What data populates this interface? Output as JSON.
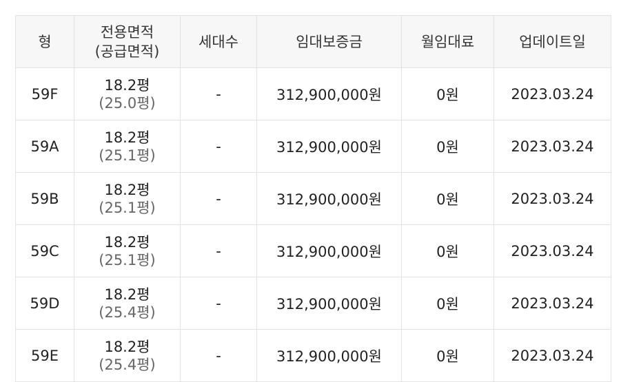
{
  "table": {
    "headers": {
      "type": "형",
      "area_line1": "전용면적",
      "area_line2": "(공급면적)",
      "households": "세대수",
      "deposit": "임대보증금",
      "rent": "월임대료",
      "updated": "업데이트일"
    },
    "rows": [
      {
        "type": "59F",
        "exclusive": "18.2평",
        "supply": "(25.0평)",
        "households": "-",
        "deposit": "312,900,000원",
        "rent": "0원",
        "updated": "2023.03.24"
      },
      {
        "type": "59A",
        "exclusive": "18.2평",
        "supply": "(25.1평)",
        "households": "-",
        "deposit": "312,900,000원",
        "rent": "0원",
        "updated": "2023.03.24"
      },
      {
        "type": "59B",
        "exclusive": "18.2평",
        "supply": "(25.1평)",
        "households": "-",
        "deposit": "312,900,000원",
        "rent": "0원",
        "updated": "2023.03.24"
      },
      {
        "type": "59C",
        "exclusive": "18.2평",
        "supply": "(25.1평)",
        "households": "-",
        "deposit": "312,900,000원",
        "rent": "0원",
        "updated": "2023.03.24"
      },
      {
        "type": "59D",
        "exclusive": "18.2평",
        "supply": "(25.4평)",
        "households": "-",
        "deposit": "312,900,000원",
        "rent": "0원",
        "updated": "2023.03.24"
      },
      {
        "type": "59E",
        "exclusive": "18.2평",
        "supply": "(25.4평)",
        "households": "-",
        "deposit": "312,900,000원",
        "rent": "0원",
        "updated": "2023.03.24"
      }
    ]
  }
}
